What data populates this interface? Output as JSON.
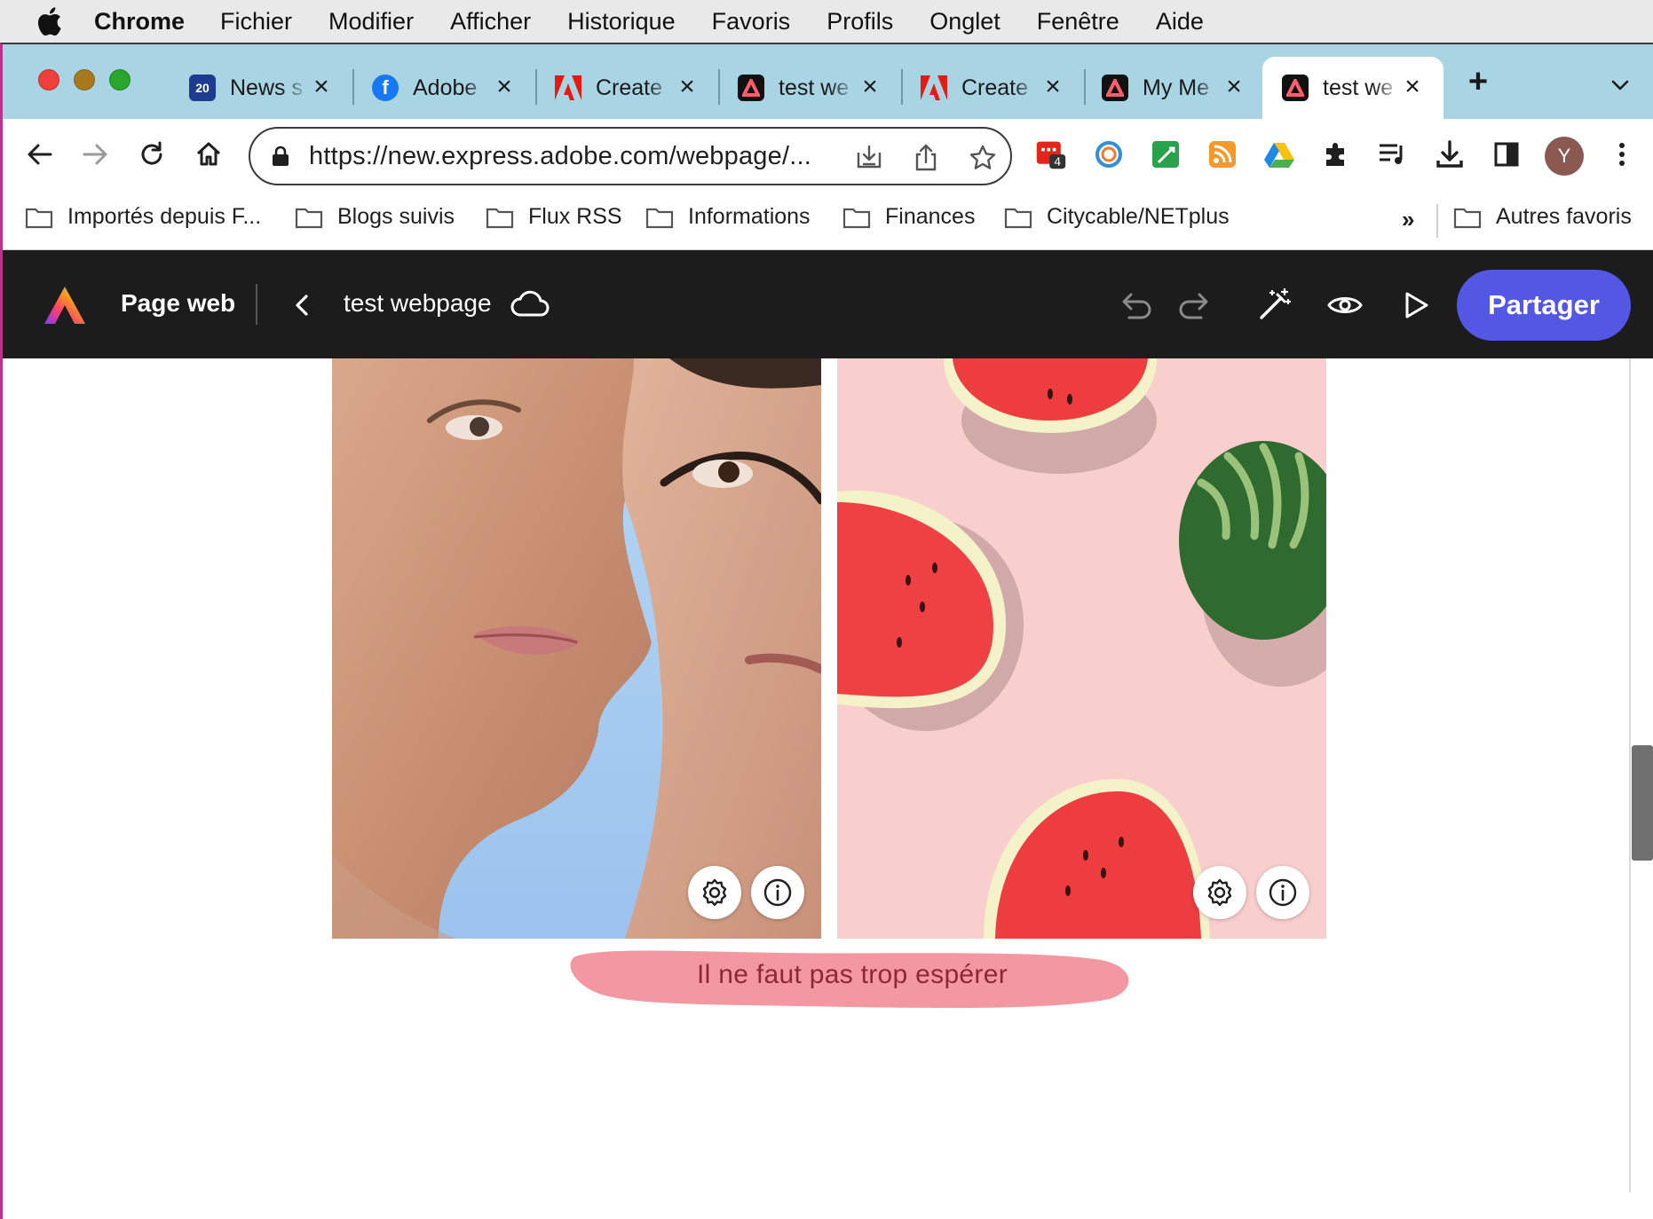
{
  "menubar": {
    "app": "Chrome",
    "items": [
      "Fichier",
      "Modifier",
      "Afficher",
      "Historique",
      "Favoris",
      "Profils",
      "Onglet",
      "Fenêtre",
      "Aide"
    ]
  },
  "tabs": [
    {
      "title": "News s",
      "icon": "news-20min-icon",
      "active": false
    },
    {
      "title": "Adobe",
      "icon": "facebook-icon",
      "active": false
    },
    {
      "title": "Create",
      "icon": "adobe-icon",
      "active": false
    },
    {
      "title": "test we",
      "icon": "adobe-express-icon",
      "active": false
    },
    {
      "title": "Create",
      "icon": "adobe-icon",
      "active": false
    },
    {
      "title": "My Me",
      "icon": "adobe-express-icon",
      "active": false
    },
    {
      "title": "test we",
      "icon": "adobe-express-icon",
      "active": true
    }
  ],
  "toolbar": {
    "url": "https://new.express.adobe.com/webpage/...",
    "extension_badge": "4",
    "avatar_initial": "Y"
  },
  "bookmarks": {
    "items": [
      "Importés depuis F...",
      "Blogs suivis",
      "Flux RSS",
      "Informations",
      "Finances",
      "Citycable/NETplus"
    ],
    "overflow": "»",
    "other": "Autres favoris"
  },
  "express": {
    "app_title": "Page web",
    "document_name": "test webpage",
    "share_label": "Partager"
  },
  "content": {
    "caption": "Il ne faut pas trop espérer"
  },
  "colors": {
    "express_header": "#1c1c1c",
    "share_button": "#5258e4",
    "tabstrip": "#a8d4e3",
    "caption_highlight": "#f28d96"
  }
}
